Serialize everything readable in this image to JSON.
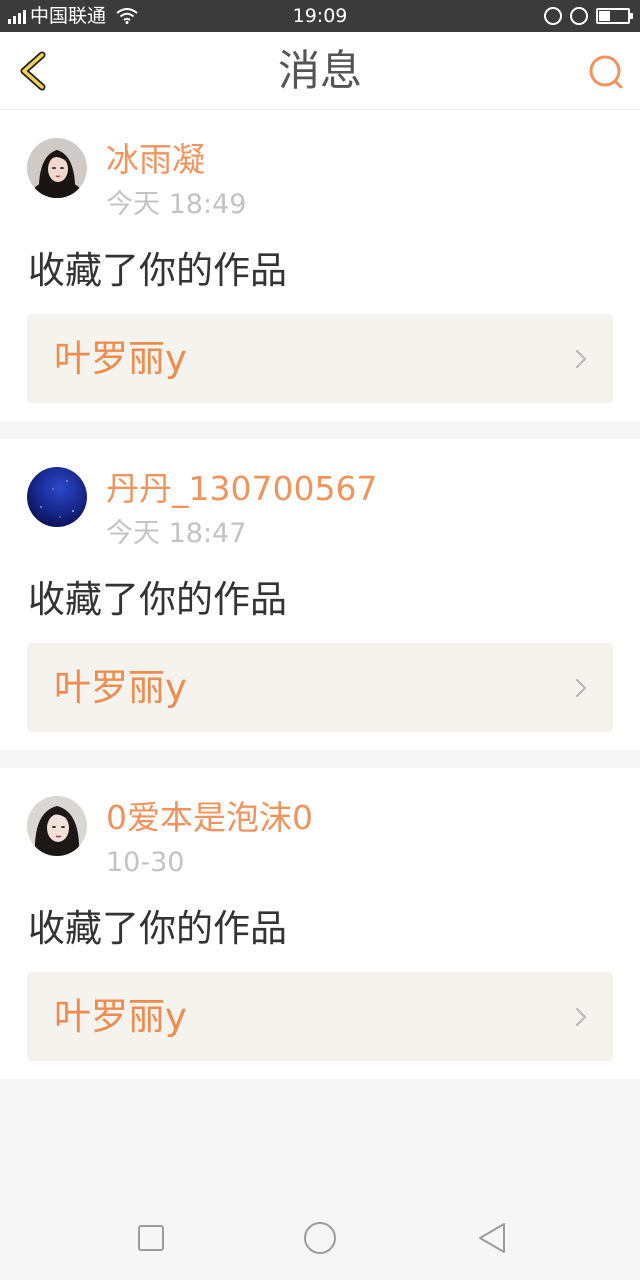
{
  "status_bar": {
    "network": "4G",
    "carrier": "中国联通",
    "time": "19:09",
    "battery_level": 0.4
  },
  "header": {
    "title": "消息",
    "back_icon": "chevron-left-icon",
    "search_icon": "search-icon",
    "accent_color": "#f1935c"
  },
  "messages": [
    {
      "user": "冰雨凝",
      "time": "今天 18:49",
      "action": "收藏了你的作品",
      "work_title": "叶罗丽y"
    },
    {
      "user": "丹丹_130700567",
      "time": "今天 18:47",
      "action": "收藏了你的作品",
      "work_title": "叶罗丽y"
    },
    {
      "user": "0爱本是泡沫0",
      "time": "10-30",
      "action": "收藏了你的作品",
      "work_title": "叶罗丽y"
    }
  ],
  "nav": {
    "recent_icon": "square-icon",
    "home_icon": "circle-icon",
    "back_icon": "triangle-back-icon"
  }
}
